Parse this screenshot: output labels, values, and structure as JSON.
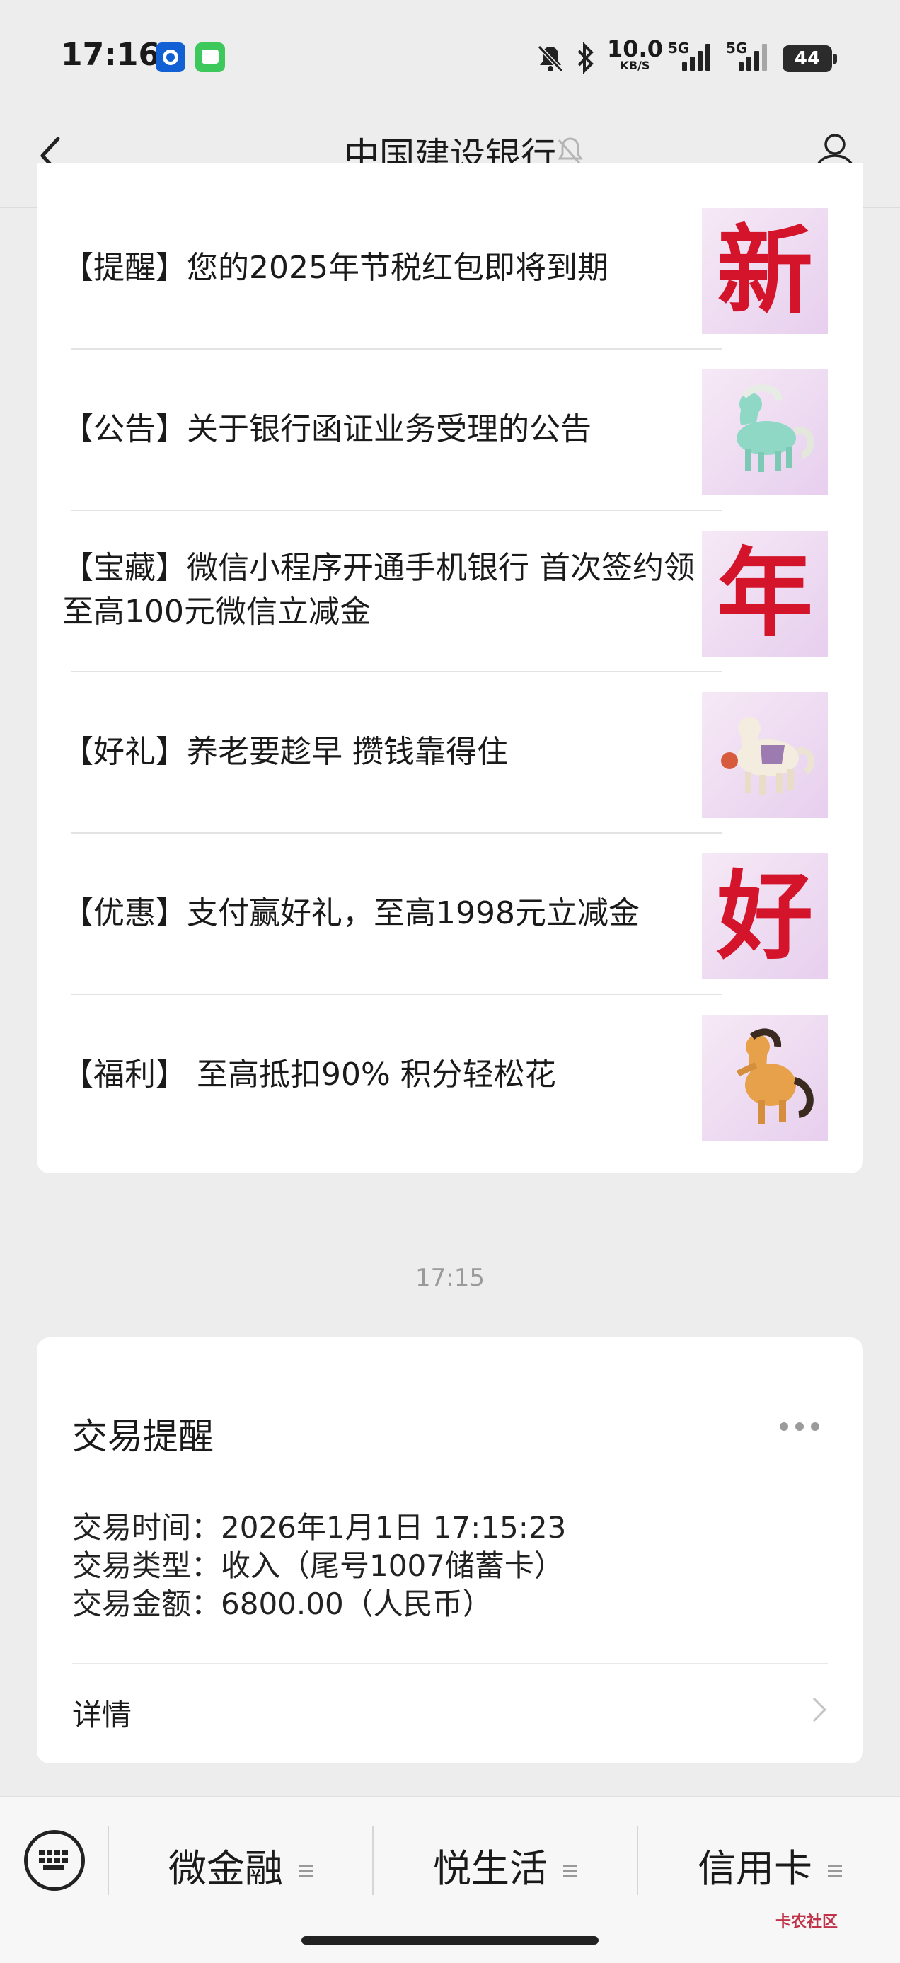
{
  "status_bar": {
    "time": "17:16",
    "net_speed": "10.0",
    "net_speed_unit": "KB/S",
    "sim1_label": "5G",
    "sim2_label": "5G",
    "battery": "44"
  },
  "header": {
    "title": "中国建设银行"
  },
  "news": [
    {
      "text": "【提醒】您的2025年节税红包即将到期",
      "thumb": "新"
    },
    {
      "text": "【公告】关于银行函证业务受理的公告",
      "thumb": "horse-figurine"
    },
    {
      "text": "【宝藏】微信小程序开通手机银行 首次签约领至高100元微信立减金",
      "thumb": "年"
    },
    {
      "text": "【好礼】养老要趁早 攒钱靠得住",
      "thumb": "horse-figurine"
    },
    {
      "text": "【优惠】支付赢好礼，至高1998元立减金",
      "thumb": "好"
    },
    {
      "text": "【福利】 至高抵扣90% 积分轻松花",
      "thumb": "horse-figurine"
    }
  ],
  "timestamp": "17:15",
  "transaction": {
    "title": "交易提醒",
    "time_line": "交易时间：2026年1月1日 17:15:23",
    "type_line": "交易类型：收入（尾号1007储蓄卡）",
    "amount_line": "交易金额：6800.00（人民币）",
    "detail_label": "详情"
  },
  "bottom_menu": {
    "items": [
      "微金融",
      "悦生活",
      "信用卡"
    ]
  },
  "watermark": "卡农社区"
}
